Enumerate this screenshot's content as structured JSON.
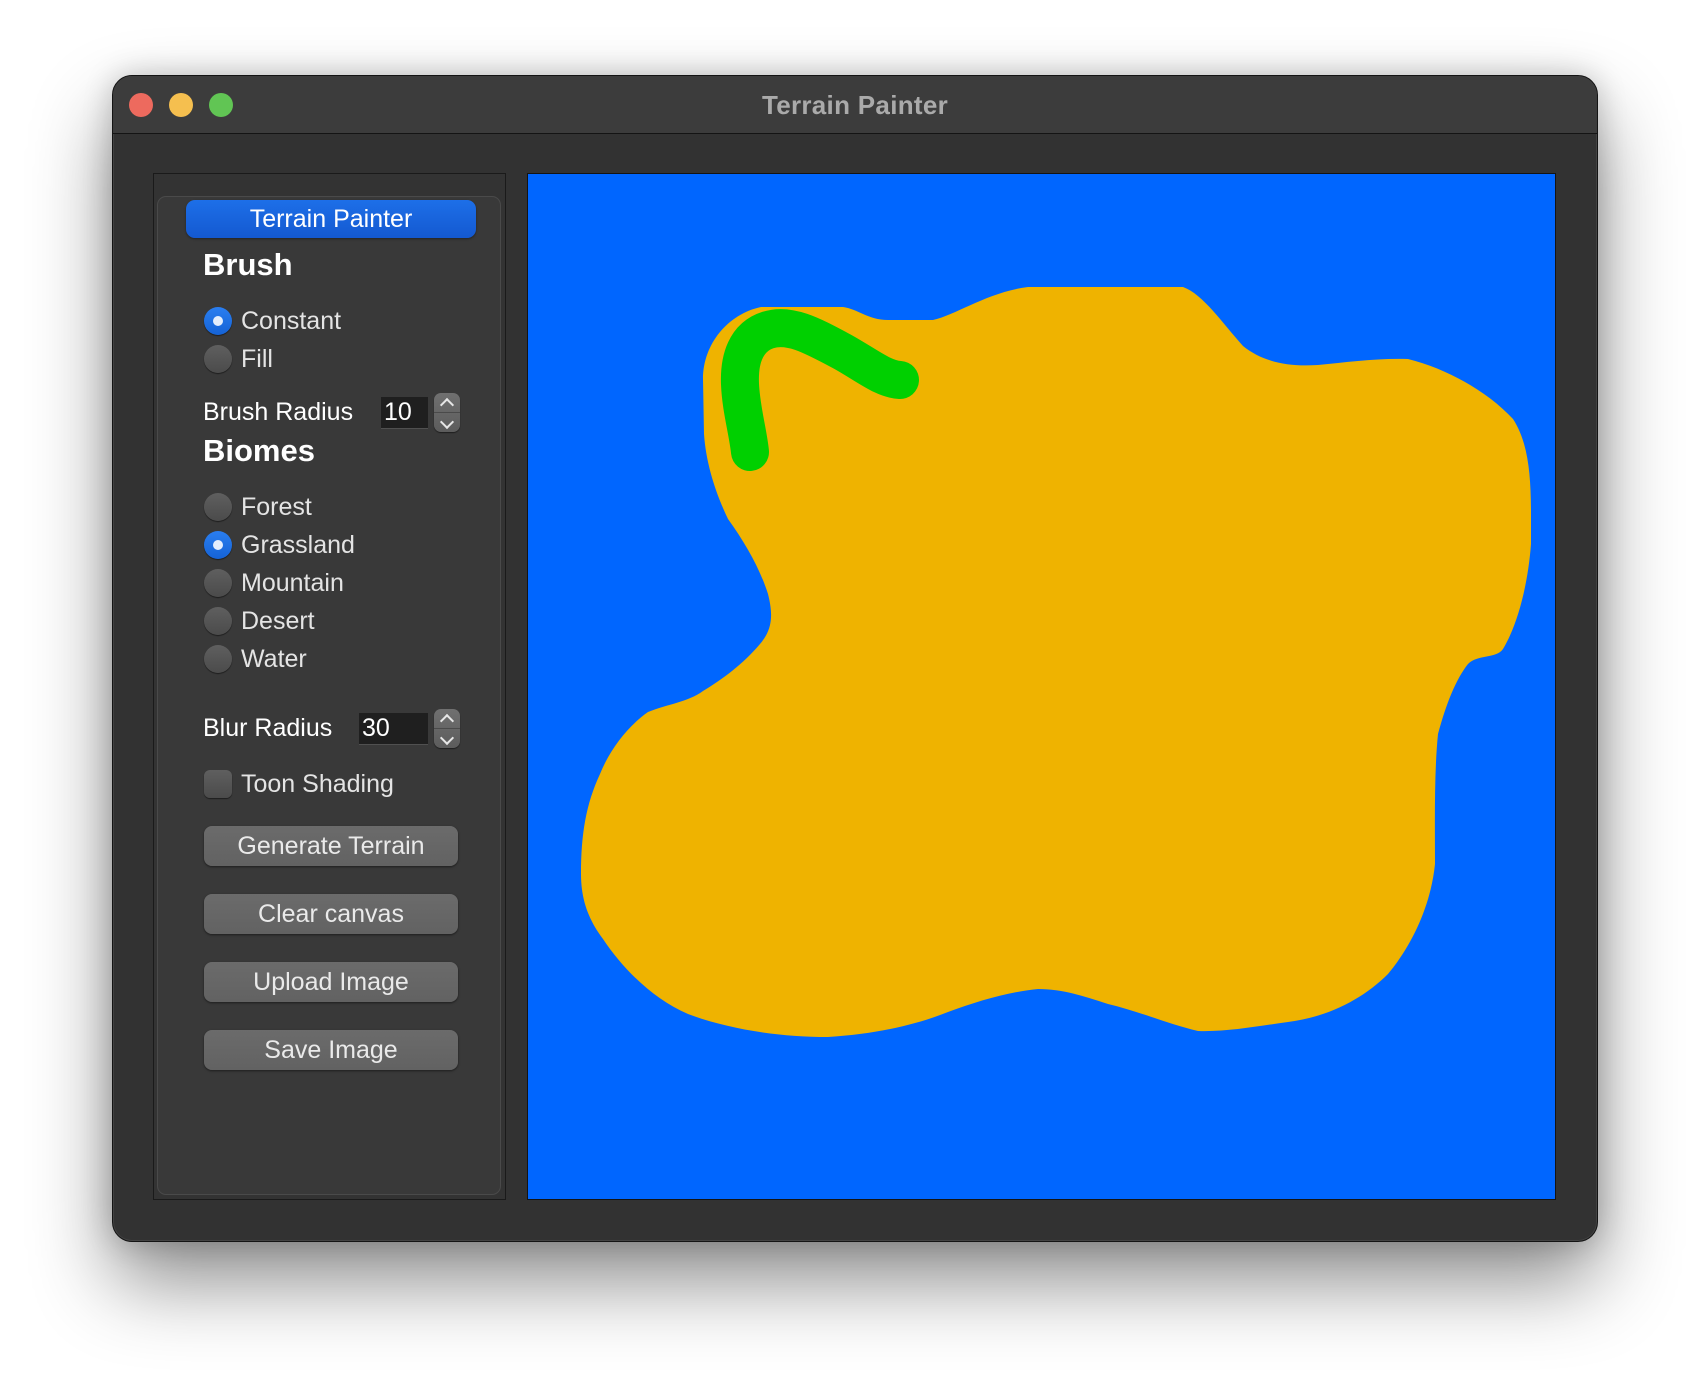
{
  "window": {
    "title": "Terrain Painter",
    "controls": [
      "close",
      "minimize",
      "maximize"
    ]
  },
  "sidebar": {
    "group_title": "Terrain Painter",
    "brush": {
      "heading": "Brush",
      "options": [
        {
          "label": "Constant",
          "checked": true
        },
        {
          "label": "Fill",
          "checked": false
        }
      ],
      "radius_label": "Brush Radius",
      "radius_value": "10"
    },
    "biomes": {
      "heading": "Biomes",
      "options": [
        {
          "label": "Forest",
          "checked": false
        },
        {
          "label": "Grassland",
          "checked": true
        },
        {
          "label": "Mountain",
          "checked": false
        },
        {
          "label": "Desert",
          "checked": false
        },
        {
          "label": "Water",
          "checked": false
        }
      ],
      "blur_label": "Blur Radius",
      "blur_value": "30"
    },
    "toon_shading": {
      "label": "Toon Shading",
      "checked": false
    },
    "buttons": {
      "generate": "Generate Terrain",
      "clear": "Clear canvas",
      "upload": "Upload Image",
      "save": "Save Image"
    }
  },
  "canvas": {
    "colors": {
      "water": "#0066ff",
      "desert": "#efb300",
      "grassland": "#00d000"
    },
    "regions": [
      "water",
      "desert",
      "grassland"
    ]
  },
  "colors": {
    "accent": "#1a6fe4",
    "window_bg": "#323232",
    "titlebar_bg": "#3c3c3c",
    "close": "#ed6a5e",
    "minimize": "#f5bf4f",
    "maximize": "#61c554"
  }
}
